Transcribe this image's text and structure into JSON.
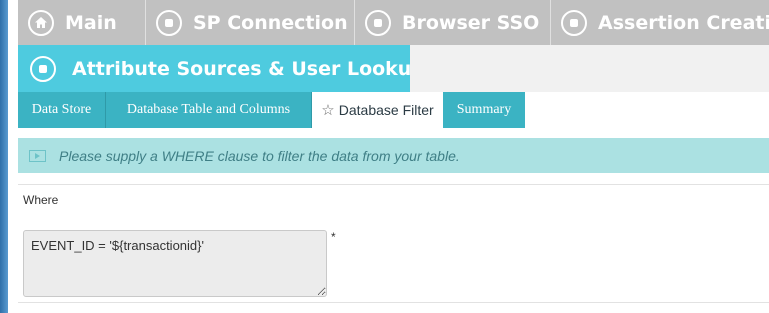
{
  "wizard_tabs": [
    {
      "label": "Main",
      "icon": "home-icon"
    },
    {
      "label": "SP Connection",
      "icon": "circle-step-icon"
    },
    {
      "label": "Browser SSO",
      "icon": "circle-step-icon"
    },
    {
      "label": "Assertion Creation",
      "icon": "circle-step-icon"
    }
  ],
  "active_step": {
    "label": "Attribute Sources & User Lookup",
    "icon": "circle-step-icon"
  },
  "sub_tabs": [
    {
      "label": "Data Store"
    },
    {
      "label": "Database Table and Columns"
    },
    {
      "label": "Database Filter",
      "active": true,
      "icon": "star-icon"
    },
    {
      "label": "Summary"
    }
  ],
  "info": {
    "text": "Please supply a WHERE clause to filter the data from your table."
  },
  "form": {
    "where_label": "Where",
    "where_value": "EVENT_ID = '${transactionid}'",
    "required_mark": "*"
  },
  "colors": {
    "tab_gray": "#c1c1c1",
    "active_teal": "#4ecbdf",
    "subtab_teal": "#3bb3c3",
    "info_bg": "#abe1e2"
  }
}
